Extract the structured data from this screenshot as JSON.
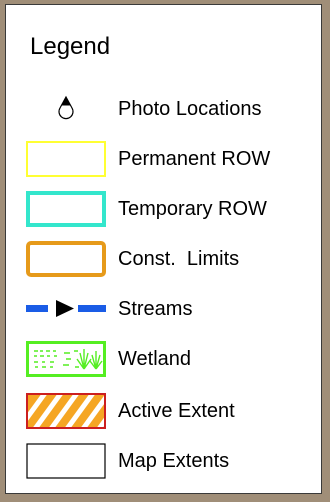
{
  "legend": {
    "title": "Legend",
    "items": [
      {
        "label": "Photo Locations",
        "symbol": "photo-marker-icon"
      },
      {
        "label": "Permanent ROW",
        "symbol": "yellow-outline",
        "color": "#ffff33"
      },
      {
        "label": "Temporary ROW",
        "symbol": "cyan-outline",
        "color": "#33e6cc"
      },
      {
        "label": "Const.  Limits",
        "symbol": "orange-outline",
        "color": "#e69a1a"
      },
      {
        "label": "Streams",
        "symbol": "stream-arrow-icon",
        "color": "#1a5ce6"
      },
      {
        "label": "Wetland",
        "symbol": "wetland-pattern",
        "color": "#55ee22"
      },
      {
        "label": "Active Extent",
        "symbol": "hatched-fill",
        "colors": [
          "#f5a623",
          "#cc1f1f"
        ]
      },
      {
        "label": "Map Extents",
        "symbol": "black-outline",
        "color": "#000000"
      }
    ]
  }
}
